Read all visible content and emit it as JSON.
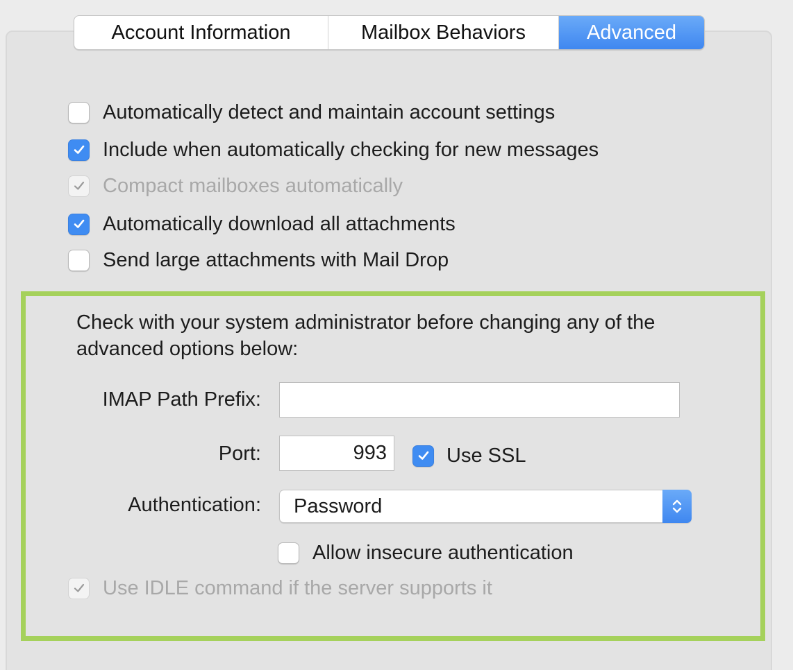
{
  "tabs": [
    {
      "label": "Account Information",
      "active": false
    },
    {
      "label": "Mailbox Behaviors",
      "active": false
    },
    {
      "label": "Advanced",
      "active": true
    }
  ],
  "options": [
    {
      "label": "Automatically detect and maintain account settings",
      "checked": false,
      "disabled": false
    },
    {
      "label": "Include when automatically checking for new messages",
      "checked": true,
      "disabled": false
    },
    {
      "label": "Compact mailboxes automatically",
      "checked": true,
      "disabled": true
    },
    {
      "label": "Automatically download all attachments",
      "checked": true,
      "disabled": false
    },
    {
      "label": "Send large attachments with Mail Drop",
      "checked": false,
      "disabled": false
    }
  ],
  "advanced": {
    "note": "Check with your system administrator before changing any of the advanced options below:",
    "imap_prefix_label": "IMAP Path Prefix:",
    "imap_prefix_value": "",
    "port_label": "Port:",
    "port_value": "993",
    "use_ssl_label": "Use SSL",
    "use_ssl_checked": true,
    "auth_label": "Authentication:",
    "auth_value": "Password",
    "allow_insecure_label": "Allow insecure authentication",
    "allow_insecure_checked": false,
    "idle_label": "Use IDLE command if the server supports it",
    "idle_checked": true,
    "idle_disabled": true
  },
  "colors": {
    "accent": "#3f8cf2",
    "highlight_border": "#a5d15b",
    "panel_background": "#e3e3e3",
    "disabled_text": "#a8a8a8"
  },
  "icons": {
    "checkmark": "checkmark-icon",
    "select_arrows": "up-down-chevron-icon"
  }
}
